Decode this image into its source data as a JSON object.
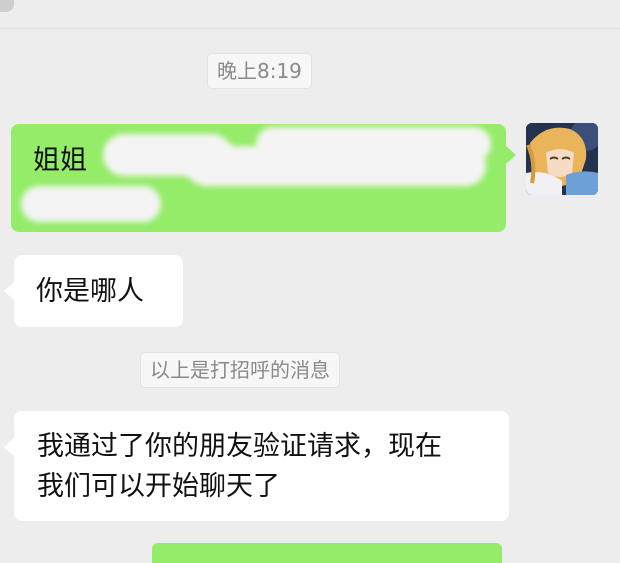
{
  "chat": {
    "timestamp": "晚上8:19",
    "sent_message_visible": "姐姐",
    "reply_1": "你是哪人",
    "greeting_notice": "以上是打招呼的消息",
    "system_message_line1": "我通过了你的朋友验证请求，现在",
    "system_message_line2": "我们可以开始聊天了"
  },
  "colors": {
    "background": "#ededed",
    "sent_bubble": "#95ec69",
    "received_bubble": "#ffffff",
    "system_text": "#8a8a8a"
  },
  "icons": {
    "avatar": "anime-girl-avatar"
  }
}
